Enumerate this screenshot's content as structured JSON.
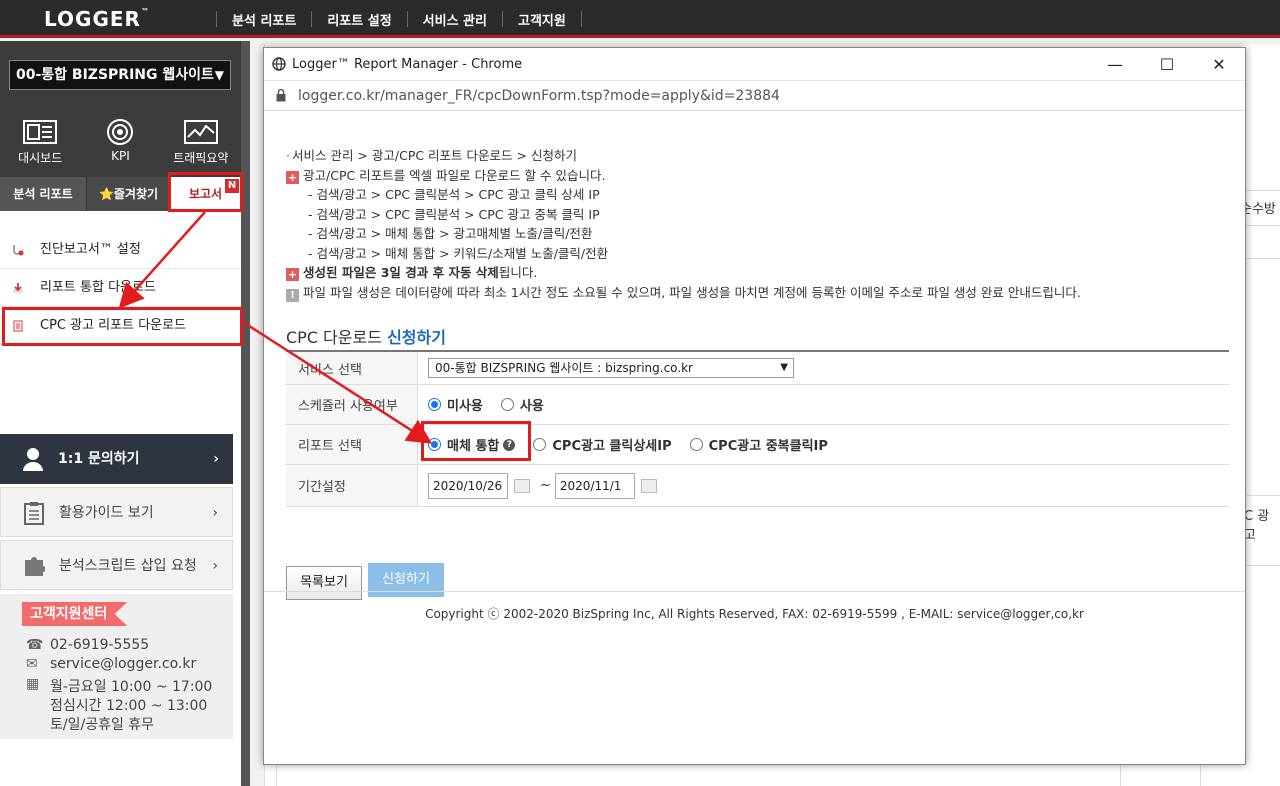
{
  "topbar": {
    "logo": "LOGGER",
    "logo_tm": "™",
    "nav": [
      "분석 리포트",
      "리포트 설정",
      "서비스 관리",
      "고객지원"
    ]
  },
  "sidebar": {
    "site_select": "00-통합 BIZSPRING 웹사이트",
    "dash": [
      {
        "label": "대시보드",
        "icon": "dashboard-icon"
      },
      {
        "label": "KPI",
        "icon": "target-icon"
      },
      {
        "label": "트래픽요약",
        "icon": "traffic-chart-icon"
      }
    ],
    "tabs": [
      "분석 리포트",
      "⭐즐겨찾기",
      "보고서"
    ],
    "tab_badge": "N",
    "menu": [
      "진단보고서™ 설정",
      "리포트 통합 다운로드",
      "CPC 광고 리포트 다운로드"
    ],
    "buttons": [
      "1:1 문의하기",
      "활용가이드 보기",
      "분석스크립트 삽입 요청"
    ],
    "support": {
      "title": "고객지원센터",
      "phone": "02-6919-5555",
      "email": "service@logger.co.kr",
      "hours1": "월-금요일  10:00 ~ 17:00",
      "hours2": "점심시간  12:00 ~ 13:00",
      "hours3": "토/일/공휴일 휴무"
    }
  },
  "background": {
    "right_text1": "순수방",
    "right_text2": "C 광고"
  },
  "window": {
    "title": "Logger™ Report Manager - Chrome",
    "url": "logger.co.kr/manager_FR/cpcDownForm.tsp?mode=apply&id=23884"
  },
  "content": {
    "breadcrumb": "서비스 관리 > 광고/CPC 리포트 다운로드 > 신청하기",
    "info1": "광고/CPC 리포트를 엑셀 파일로 다운로드 할 수 있습니다.",
    "sub": [
      "- 검색/광고 > CPC 클릭분석 > CPC 광고 클릭 상세 IP",
      "- 검색/광고 > CPC 클릭분석 > CPC 광고 중복 클릭 IP",
      "- 검색/광고 > 매체 통합 > 광고매체별 노출/클릭/전환",
      "- 검색/광고 > 매체 통합 > 키워드/소재별 노출/클릭/전환"
    ],
    "info2_bold": "생성된 파일은 3일 경과 후 자동 삭제",
    "info2_rest": "됩니다.",
    "info3": "파일 파일 생성은 데이터량에 따라 최소 1시간 정도 소요될 수 있으며, 파일 생성을 마치면 계정에 등록한 이메일 주소로 파일 생성 완료 안내드립니다.",
    "section_title": "CPC 다운로드",
    "section_title_blue": "신청하기",
    "form": {
      "service_label": "서비스 선택",
      "service_value": "00-통합 BIZSPRING 웹사이트 : bizspring.co.kr",
      "scheduler_label": "스케쥴러 사용여부",
      "scheduler_options": [
        "미사용",
        "사용"
      ],
      "report_label": "리포트 선택",
      "report_options": [
        "매체 통합",
        "CPC광고 클릭상세IP",
        "CPC광고 중복클릭IP"
      ],
      "period_label": "기간설정",
      "date_from": "2020/10/26",
      "date_to": "2020/11/1",
      "tilde": "~"
    },
    "btn_list": "목록보기",
    "btn_apply": "신청하기",
    "footer": "Copyright ⓒ 2002-2020 BizSpring Inc, All Rights Reserved, FAX: 02-6919-5599 , E-MAIL: service@logger,co,kr"
  },
  "colors": {
    "accent_red": "#e21c1c",
    "brand_blue": "#1f6ab5",
    "dark": "#2b2b2b"
  }
}
